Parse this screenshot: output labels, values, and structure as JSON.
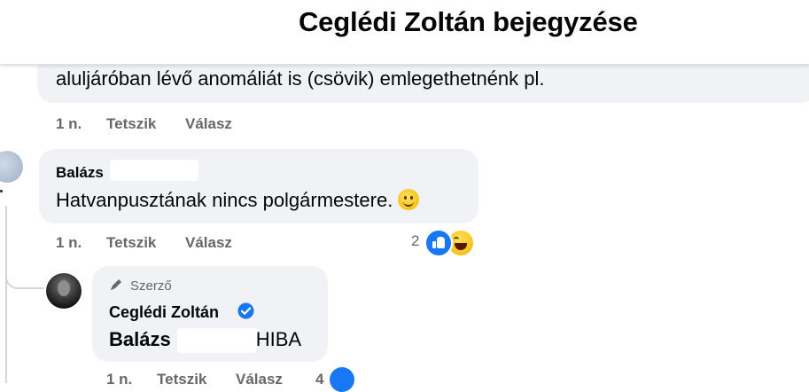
{
  "header": {
    "title": "Ceglédi Zoltán bejegyzése"
  },
  "comments": [
    {
      "text": "aluljáróban lévő anomáliát is (csövik) emlegethetnénk pl.",
      "actions": {
        "time": "1 n.",
        "like": "Tetszik",
        "reply": "Válasz"
      }
    },
    {
      "author": "Balázs",
      "text": "Hatvanpusztának nincs polgármestere.",
      "emoji_icon": "slightly-smiling-face",
      "actions": {
        "time": "1 n.",
        "like": "Tetszik",
        "reply": "Válasz"
      },
      "reactions": {
        "count": "2",
        "types": [
          "like",
          "haha"
        ]
      }
    },
    {
      "author_label": "Szerző",
      "author": "Ceglédi Zoltán",
      "verified": true,
      "mention": "Balázs",
      "text_suffix": "HIBA",
      "actions": {
        "time": "1 n.",
        "like": "Tetszik",
        "reply": "Válasz"
      },
      "reactions": {
        "count": "4"
      }
    }
  ],
  "colors": {
    "bubble": "#f0f2f5",
    "meta_text": "#65676b",
    "like_blue": "#1877f2",
    "verified_blue": "#1877f2"
  }
}
